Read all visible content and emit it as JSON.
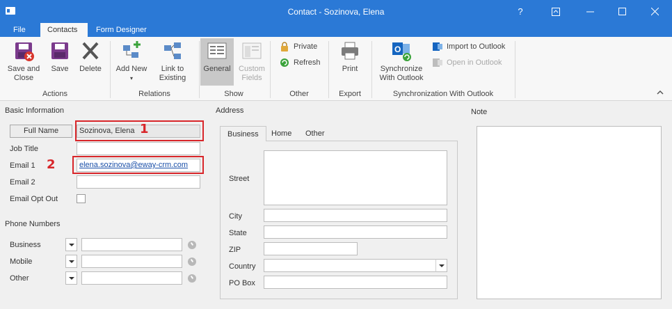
{
  "window": {
    "title": "Contact - Sozinova, Elena",
    "controls": [
      "?",
      "restore",
      "minimize",
      "maximize",
      "close"
    ]
  },
  "tabs": [
    {
      "label": "File",
      "active": false
    },
    {
      "label": "Contacts",
      "active": true
    },
    {
      "label": "Form Designer",
      "active": false
    }
  ],
  "ribbon": {
    "save_close": "Save and Close",
    "save": "Save",
    "delete": "Delete",
    "group_actions": "Actions",
    "add_new": "Add New",
    "link_existing": "Link to Existing",
    "group_relations": "Relations",
    "general": "General",
    "custom_fields": "Custom Fields",
    "group_show": "Show",
    "private": "Private",
    "refresh": "Refresh",
    "group_other": "Other",
    "print": "Print",
    "group_export": "Export",
    "synchronize": "Synchronize With Outlook",
    "import_outlook": "Import to Outlook",
    "open_outlook": "Open in Outlook",
    "group_sync": "Synchronization With Outlook"
  },
  "basic": {
    "title": "Basic Information",
    "full_name_btn": "Full Name",
    "full_name_value": "Sozinova, Elena",
    "job_title_label": "Job Title",
    "job_title_value": "",
    "email1_label": "Email 1",
    "email1_value": "elena.sozinova@eway-crm.com",
    "email2_label": "Email 2",
    "email2_value": "",
    "email_opt_out_label": "Email Opt Out"
  },
  "annotations": {
    "marker1": "1",
    "marker2": "2",
    "color": "#d8262a"
  },
  "phones": {
    "title": "Phone Numbers",
    "rows": [
      {
        "label": "Business",
        "value": ""
      },
      {
        "label": "Mobile",
        "value": ""
      },
      {
        "label": "Other",
        "value": ""
      }
    ]
  },
  "address": {
    "title": "Address",
    "tabs": [
      {
        "label": "Business",
        "active": true
      },
      {
        "label": "Home",
        "active": false
      },
      {
        "label": "Other",
        "active": false
      }
    ],
    "street_label": "Street",
    "city_label": "City",
    "state_label": "State",
    "zip_label": "ZIP",
    "country_label": "Country",
    "pobox_label": "PO Box"
  },
  "note": {
    "title": "Note",
    "value": ""
  }
}
